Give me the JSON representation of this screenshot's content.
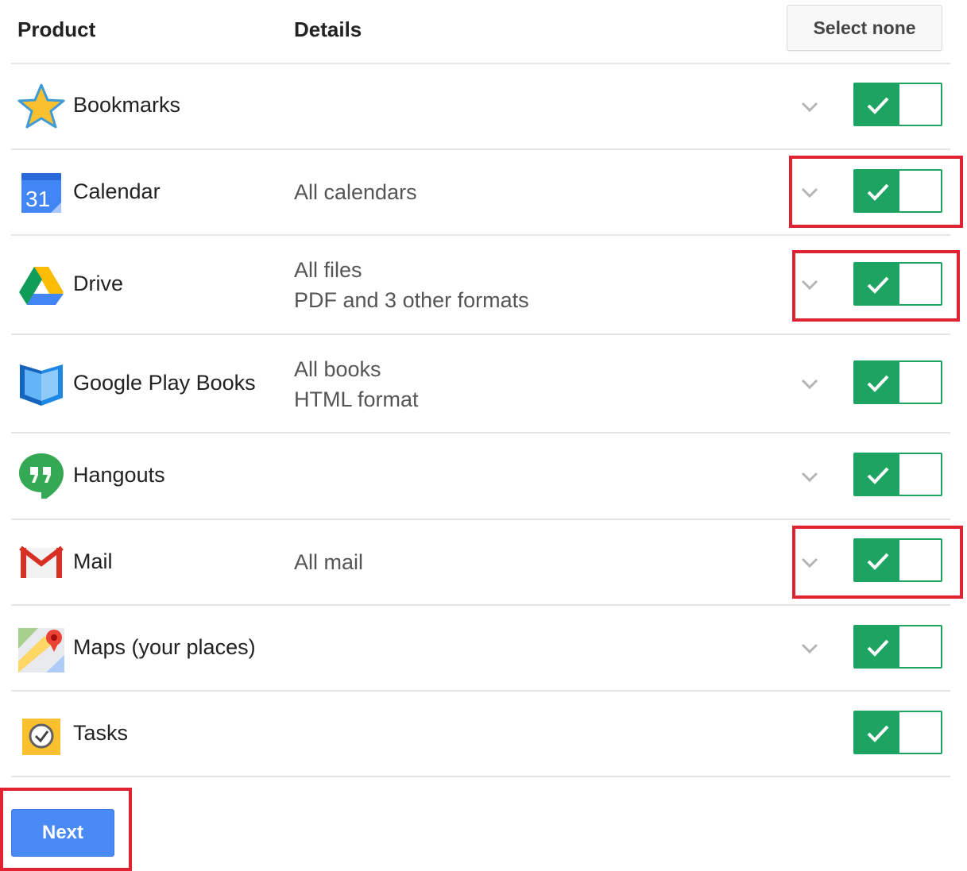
{
  "header": {
    "product_label": "Product",
    "details_label": "Details",
    "select_none_label": "Select none"
  },
  "products": [
    {
      "name": "Bookmarks",
      "details": [],
      "icon": "star-icon",
      "has_chevron": true,
      "enabled": true
    },
    {
      "name": "Calendar",
      "details": [
        "All calendars"
      ],
      "icon": "calendar-icon",
      "has_chevron": true,
      "enabled": true
    },
    {
      "name": "Drive",
      "details": [
        "All files",
        "PDF and 3 other formats"
      ],
      "icon": "drive-icon",
      "has_chevron": true,
      "enabled": true
    },
    {
      "name": "Google Play Books",
      "details": [
        "All books",
        "HTML format"
      ],
      "icon": "play-books-icon",
      "has_chevron": true,
      "enabled": true
    },
    {
      "name": "Hangouts",
      "details": [],
      "icon": "hangouts-icon",
      "has_chevron": true,
      "enabled": true
    },
    {
      "name": "Mail",
      "details": [
        "All mail"
      ],
      "icon": "gmail-icon",
      "has_chevron": true,
      "enabled": true
    },
    {
      "name": "Maps (your places)",
      "details": [],
      "icon": "maps-icon",
      "has_chevron": true,
      "enabled": true
    },
    {
      "name": "Tasks",
      "details": [],
      "icon": "tasks-icon",
      "has_chevron": false,
      "enabled": true
    }
  ],
  "footer": {
    "next_label": "Next"
  },
  "colors": {
    "toggle_green": "#1da462",
    "next_blue": "#4a8af4",
    "highlight_red": "#e02232"
  }
}
